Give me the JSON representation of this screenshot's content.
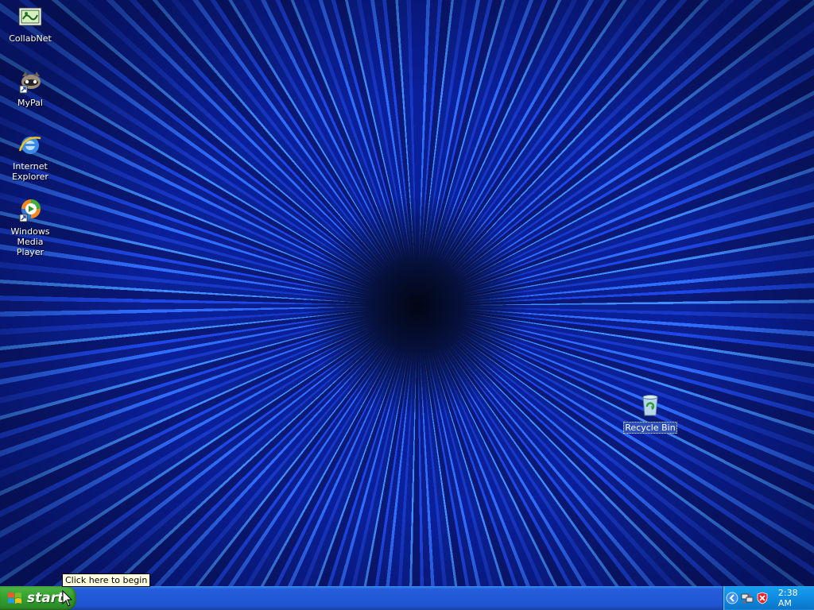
{
  "desktop": {
    "icons": [
      {
        "label": "CollabNet",
        "icon": "collabnet-icon"
      },
      {
        "label": "MyPal",
        "icon": "mypal-icon"
      },
      {
        "label": "Internet\nExplorer",
        "icon": "internet-explorer-icon"
      },
      {
        "label": "Windows Media\nPlayer",
        "icon": "windows-media-player-icon"
      },
      {
        "label": "Recycle Bin",
        "icon": "recycle-bin-icon"
      }
    ],
    "tooltip": "Click here to begin"
  },
  "taskbar": {
    "start_label": "start",
    "clock": "2:38 AM",
    "tray_icons": [
      "show-hidden-icons-icon",
      "network-icon",
      "security-alert-icon"
    ]
  },
  "colors": {
    "taskbar": "#245edb",
    "start_button": "#38a534",
    "tray": "#0f8ae0",
    "tooltip_bg": "#ffffe1"
  }
}
